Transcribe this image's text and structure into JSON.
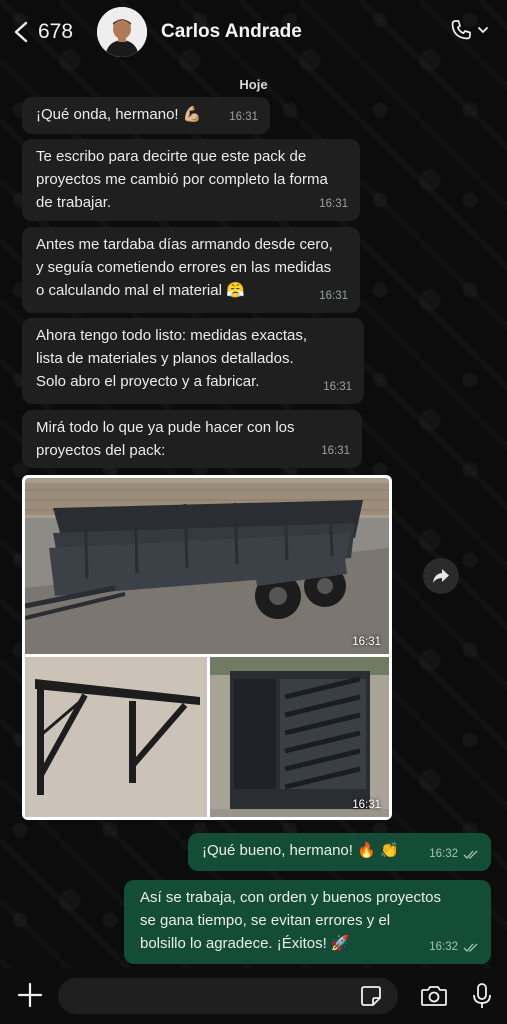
{
  "header": {
    "back_count": "678",
    "contact_name": "Carlos Andrade"
  },
  "date_chip": "Hoje",
  "messages": [
    {
      "text_lines": [
        "¡Qué onda, hermano! 💪🏼"
      ],
      "time": "16:31"
    },
    {
      "text_lines": [
        "Te escribo para decirte que este pack de",
        "proyectos me cambió por completo la forma",
        "de trabajar."
      ],
      "time": "16:31"
    },
    {
      "text_lines": [
        "Antes me tardaba días armando desde cero,",
        "y seguía cometiendo errores en las medidas",
        "o calculando mal el material 😤"
      ],
      "time": "16:31"
    },
    {
      "text_lines": [
        "Ahora tengo todo listo: medidas exactas,",
        "lista de materiales y planos detallados.",
        "Solo abro el proyecto y a fabricar."
      ],
      "time": "16:31"
    },
    {
      "text_lines": [
        "Mirá todo lo que ya pude hacer con los",
        "proyectos del pack:"
      ],
      "time": "16:31"
    }
  ],
  "images": {
    "main_time": "16:31",
    "bottom_time": "16:31"
  },
  "outgoing": [
    {
      "text_lines": [
        "¡Qué bueno, hermano! 🔥 👏"
      ],
      "time": "16:32"
    },
    {
      "text_lines": [
        "Así se trabaja, con orden y buenos proyectos",
        "se gana tiempo, se evitan errores y el",
        "bolsillo lo agradece. ¡Éxitos! 🚀"
      ],
      "time": "16:32"
    }
  ],
  "input": {
    "placeholder": ""
  },
  "icons": {
    "back": "chevron-left-icon",
    "call": "phone-icon",
    "forward": "forward-icon",
    "plus": "plus-icon",
    "sticker": "sticker-icon",
    "camera": "camera-icon",
    "mic": "mic-icon"
  },
  "colors": {
    "incoming_bubble": "#1f1f1f",
    "outgoing_bubble": "#134d37",
    "background": "#0b0b0b"
  }
}
